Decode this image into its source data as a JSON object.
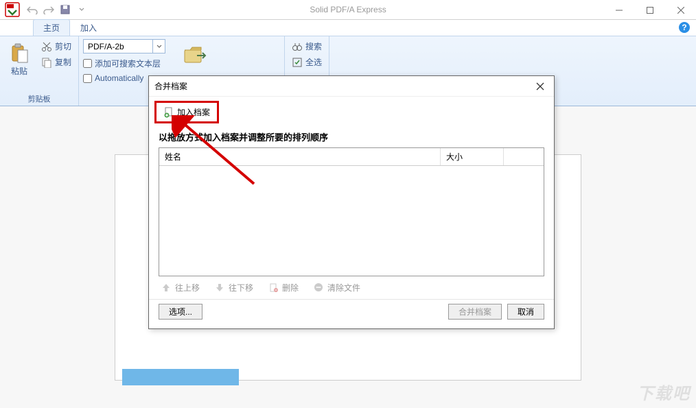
{
  "app": {
    "title": "Solid PDF/A Express"
  },
  "tabs": {
    "home": "主页",
    "insert": "加入"
  },
  "ribbon": {
    "clipboard": {
      "paste": "粘贴",
      "cut": "剪切",
      "copy": "复制",
      "group_label": "剪贴板"
    },
    "pdf": {
      "combo_value": "PDF/A-2b",
      "checkbox_searchable": "添加可搜索文本层",
      "checkbox_auto": "Automatically"
    },
    "search": {
      "search": "搜索",
      "select_all": "全选"
    }
  },
  "dialog": {
    "title": "合并档案",
    "add_file": "加入档案",
    "instruction": "以拖放方式加入档案并调整所要的排列顺序",
    "columns": {
      "name": "姓名",
      "size": "大小"
    },
    "actions": {
      "move_up": "往上移",
      "move_down": "往下移",
      "delete": "删除",
      "clear": "清除文件"
    },
    "options_btn": "选项...",
    "merge_btn": "合并档案",
    "cancel_btn": "取消"
  },
  "watermark": "下载吧"
}
